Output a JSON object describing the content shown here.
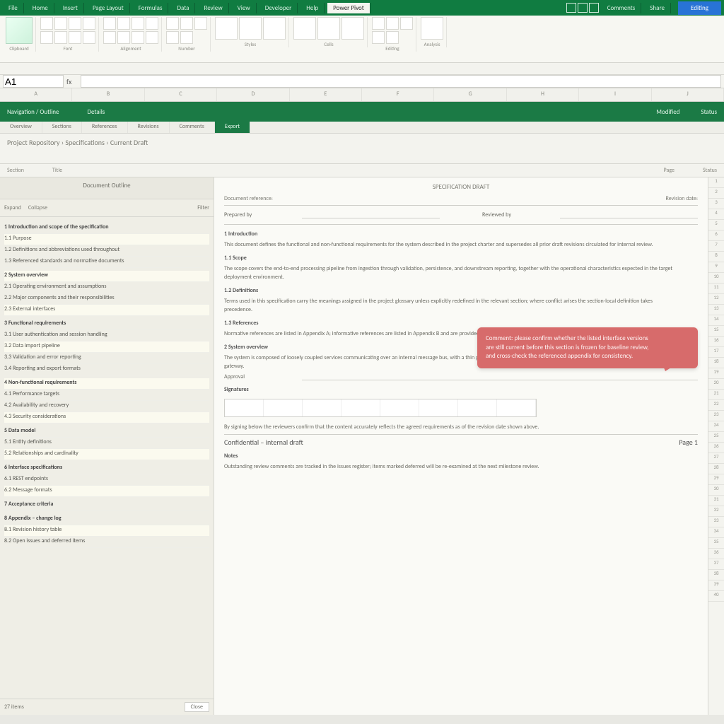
{
  "titlebar": {
    "tabs": [
      "File",
      "Home",
      "Insert",
      "Page Layout",
      "Formulas",
      "Data",
      "Review",
      "View",
      "Developer",
      "Help",
      "Power Pivot"
    ],
    "active_tab": 10,
    "right_labels": [
      "Comments",
      "Share"
    ],
    "blue_button": "Editing"
  },
  "ribbon": {
    "groups": [
      {
        "label": "Clipboard",
        "icons": 4
      },
      {
        "label": "Font",
        "icons": 8
      },
      {
        "label": "Alignment",
        "icons": 8
      },
      {
        "label": "Number",
        "icons": 5
      },
      {
        "label": "Styles",
        "icons": 6
      },
      {
        "label": "Cells",
        "icons": 3
      },
      {
        "label": "Editing",
        "icons": 5
      },
      {
        "label": "Analysis",
        "icons": 2
      }
    ]
  },
  "formula": {
    "name_box": "A1",
    "fx": "fx",
    "value": ""
  },
  "columns": [
    "A",
    "B",
    "C",
    "D",
    "E",
    "F",
    "G",
    "H",
    "I",
    "J"
  ],
  "banner": {
    "left": "Navigation / Outline",
    "mid": "Details",
    "r1": "Modified",
    "r2": "Status"
  },
  "subtabs": [
    "Overview",
    "Sections",
    "References",
    "Revisions",
    "Comments",
    "Export"
  ],
  "crumb": "Project Repository › Specifications › Current Draft",
  "secondrow": [
    "Section",
    "Title",
    "Page",
    "Status"
  ],
  "sidebar": {
    "header": "Document Outline",
    "toolbar": {
      "a": "Expand",
      "b": "Collapse",
      "c": "Filter"
    },
    "rows": [
      "1  Introduction and scope of the specification",
      "1.1  Purpose",
      "1.2  Definitions and abbreviations used throughout",
      "1.3  Referenced standards and normative documents",
      "2  System overview",
      "2.1  Operating environment and assumptions",
      "2.2  Major components and their responsibilities",
      "2.3  External interfaces",
      "3  Functional requirements",
      "3.1  User authentication and session handling",
      "3.2  Data import pipeline",
      "3.3  Validation and error reporting",
      "3.4  Reporting and export formats",
      "4  Non-functional requirements",
      "4.1  Performance targets",
      "4.2  Availability and recovery",
      "4.3  Security considerations",
      "5  Data model",
      "5.1  Entity definitions",
      "5.2  Relationships and cardinality",
      "6  Interface specifications",
      "6.1  REST endpoints",
      "6.2  Message formats",
      "7  Acceptance criteria",
      "8  Appendix – change log",
      "8.1  Revision history table",
      "8.2  Open issues and deferred items"
    ],
    "footer": {
      "left": "27 items",
      "btn": "Close"
    }
  },
  "doc": {
    "title": "SPECIFICATION DRAFT",
    "meta_left": "Document reference:",
    "meta_right": "Revision date:",
    "field1_label": "Prepared by",
    "field1_value": "",
    "field2_label": "Reviewed by",
    "field2_value": "",
    "sec_intro": "1  Introduction",
    "para1": "This document defines the functional and non-functional requirements for the system described in the project charter and supersedes all prior draft revisions circulated for internal review.",
    "sec_scope": "1.1  Scope",
    "para2": "The scope covers the end-to-end processing pipeline from ingestion through validation, persistence, and downstream reporting, together with the operational characteristics expected in the target deployment environment.",
    "sec_defs": "1.2  Definitions",
    "para3": "Terms used in this specification carry the meanings assigned in the project glossary unless explicitly redefined in the relevant section; where conflict arises the section-local definition takes precedence.",
    "sec_refs": "1.3  References",
    "para4": "Normative references are listed in Appendix A; informative references are listed in Appendix B and are provided for background only.",
    "sec_over": "2  System overview",
    "para5": "The system is composed of loosely coupled services communicating over an internal message bus, with a thin presentation layer exposed to authorised users through the standard corporate gateway.",
    "field3_label": "Approval",
    "field3_value": "",
    "sec_sign": "Signatures",
    "para6": "By signing below the reviewers confirm that the content accurately reflects the agreed requirements as of the revision date shown above.",
    "sec_notes": "Notes",
    "para7": "Outstanding review comments are tracked in the issues register; items marked deferred will be re-examined at the next milestone review.",
    "footer_left": "Confidential – internal draft",
    "footer_right": "Page 1"
  },
  "callout": {
    "line1": "Comment: please confirm whether the listed interface versions",
    "line2": "are still current before this section is frozen for baseline review,",
    "line3": "and cross-check the referenced appendix for consistency."
  },
  "rstrip": [
    "1",
    "2",
    "3",
    "4",
    "5",
    "6",
    "7",
    "8",
    "9",
    "10",
    "11",
    "12",
    "13",
    "14",
    "15",
    "16",
    "17",
    "18",
    "19",
    "20",
    "21",
    "22",
    "23",
    "24",
    "25",
    "26",
    "27",
    "28",
    "29",
    "30",
    "31",
    "32",
    "33",
    "34",
    "35",
    "36",
    "37",
    "38",
    "39",
    "40"
  ]
}
